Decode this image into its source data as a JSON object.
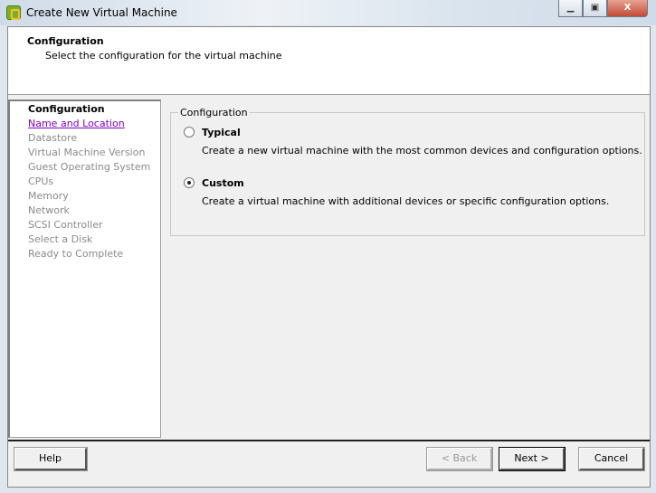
{
  "window": {
    "title": "Create New Virtual Machine",
    "controls": [
      "minimize",
      "maximize",
      "close"
    ]
  },
  "header": {
    "title": "Configuration",
    "subtitle": "Select the configuration for the virtual machine"
  },
  "nav": {
    "items": [
      {
        "label": "Configuration",
        "state": "current"
      },
      {
        "label": "Name and Location",
        "state": "link"
      },
      {
        "label": "Datastore",
        "state": "disabled"
      },
      {
        "label": "Virtual Machine Version",
        "state": "disabled"
      },
      {
        "label": "Guest Operating System",
        "state": "disabled"
      },
      {
        "label": "CPUs",
        "state": "disabled"
      },
      {
        "label": "Memory",
        "state": "disabled"
      },
      {
        "label": "Network",
        "state": "disabled"
      },
      {
        "label": "SCSI Controller",
        "state": "disabled"
      },
      {
        "label": "Select a Disk",
        "state": "disabled"
      },
      {
        "label": "Ready to Complete",
        "state": "disabled"
      }
    ]
  },
  "config": {
    "legend": "Configuration",
    "typical": {
      "label": "Typical",
      "desc": "Create a new virtual machine with the most common devices and configuration options.",
      "selected": false
    },
    "custom": {
      "label": "Custom",
      "desc": "Create a virtual machine with additional devices or specific configuration options.",
      "selected": true
    }
  },
  "buttons": {
    "help": "Help",
    "back": "< Back",
    "next": "Next >",
    "cancel": "Cancel"
  }
}
